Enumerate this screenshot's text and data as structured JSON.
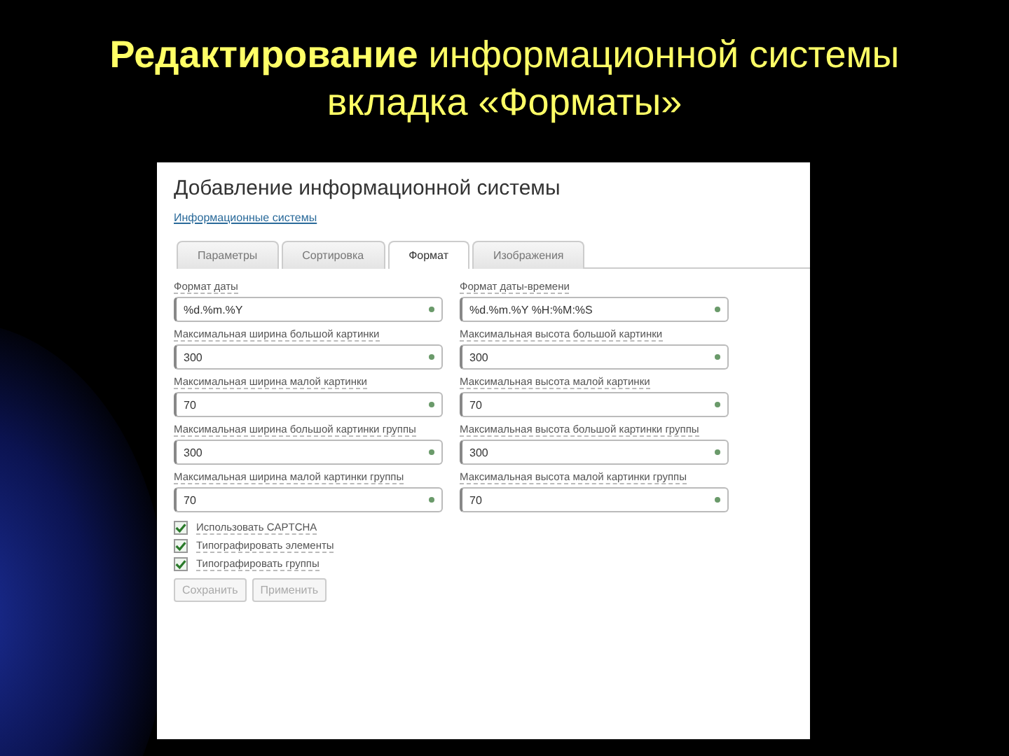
{
  "slide_title": "**Редактирование**  информационной системы вкладка «Форматы»",
  "screenshot": {
    "heading": "Добавление информационной системы",
    "breadcrumb": "Информационные системы",
    "tabs": [
      {
        "label": "Параметры",
        "selected": false
      },
      {
        "label": "Сортировка",
        "selected": false
      },
      {
        "label": "Формат",
        "selected": true
      },
      {
        "label": "Изображения",
        "selected": false
      }
    ],
    "fields": [
      {
        "label": "Формат даты",
        "value": "%d.%m.%Y"
      },
      {
        "label": "Формат даты-времени",
        "value": "%d.%m.%Y %H:%M:%S"
      },
      {
        "label": "Максимальная ширина большой картинки",
        "value": "300"
      },
      {
        "label": "Максимальная высота большой картинки",
        "value": "300"
      },
      {
        "label": "Максимальная ширина малой картинки",
        "value": "70"
      },
      {
        "label": "Максимальная высота малой картинки",
        "value": "70"
      },
      {
        "label": "Максимальная ширина большой картинки группы",
        "value": "300"
      },
      {
        "label": "Максимальная высота большой картинки группы",
        "value": "300"
      },
      {
        "label": "Максимальная ширина малой картинки группы",
        "value": "70"
      },
      {
        "label": "Максимальная высота малой картинки группы",
        "value": "70"
      }
    ],
    "checkboxes": [
      {
        "label": "Использовать CAPTCHA",
        "checked": true
      },
      {
        "label": "Типографировать элементы",
        "checked": true
      },
      {
        "label": "Типографировать группы",
        "checked": true
      }
    ],
    "buttons": [
      "Сохранить",
      "Применить"
    ]
  }
}
